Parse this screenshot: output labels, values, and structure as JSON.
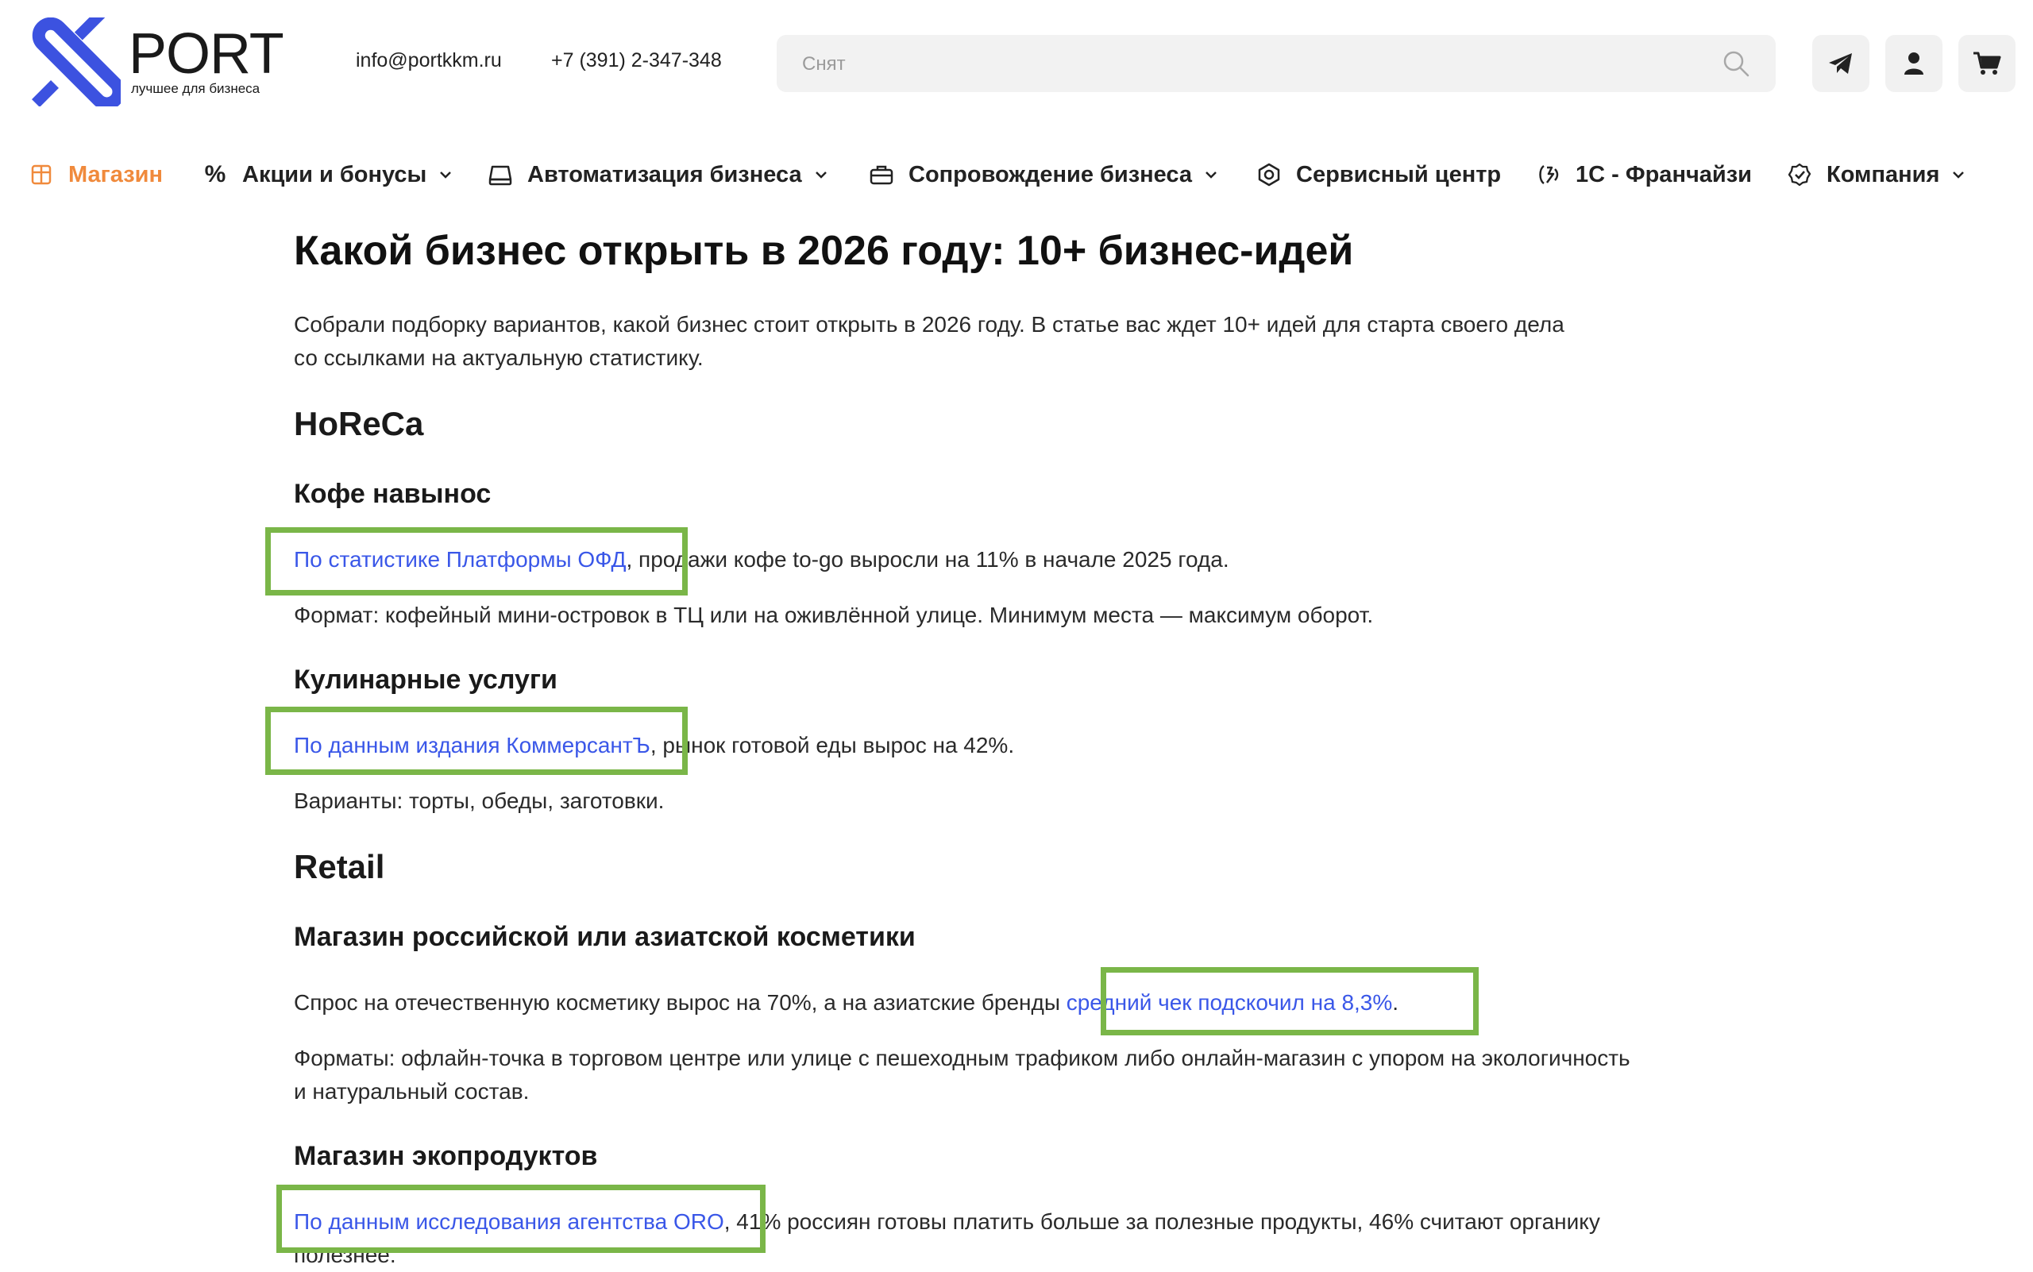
{
  "brand": {
    "name": "PORT",
    "tagline": "лучшее для бизнеса",
    "accent": "#3c52e0"
  },
  "header": {
    "email": "info@portkkm.ru",
    "phone": "+7 (391) 2-347-348",
    "search": {
      "placeholder": "Снят"
    },
    "icons": [
      "telegram-icon",
      "user-icon",
      "cart-icon"
    ]
  },
  "nav": {
    "shop": "Магазин",
    "promo": "Акции и бонусы",
    "automation": "Автоматизация бизнеса",
    "support": "Сопровождение бизнеса",
    "service": "Сервисный центр",
    "franchise": "1С - Франчайзи",
    "company": "Компания",
    "active_color": "#f08a3c"
  },
  "article": {
    "title": "Какой бизнес открыть в 2026 году: 10+ бизнес-идей",
    "intro_1": "Собрали подборку вариантов, какой бизнес стоит открыть в 2026 году. В статье вас ждет 10+ идей для старта своего дела",
    "intro_2": "со ссылками на актуальную статистику.",
    "horeca": "HoReCa",
    "coffee": {
      "heading": "Кофе навынос",
      "link": "По статистике Платформы ОФД",
      "rest": ", продажи кофе to-go выросли на 11% в начале 2025 года.",
      "format": "Формат: кофейный мини-островок в ТЦ или на оживлённой улице. Минимум места — максимум оборот."
    },
    "culinary": {
      "heading": "Кулинарные услуги",
      "link": "По данным издания КоммерсантЪ",
      "rest": ", рынок готовой еды вырос на 42%.",
      "variants": "Варианты: торты, обеды, заготовки."
    },
    "retail": "Retail",
    "cosmetics": {
      "heading": "Магазин российской или азиатской косметики",
      "text_before": "Спрос на отечественную косметику вырос на 70%, а на азиатские бренды ",
      "link": "средний чек подскочил на 8,3%",
      "text_after": ".",
      "formats_1": "Форматы: офлайн-точка в торговом центре или улице с пешеходным трафиком либо онлайн-магазин с упором на экологичность",
      "formats_2": "и натуральный состав."
    },
    "eco": {
      "heading": "Магазин экопродуктов",
      "link": "По данным исследования агентства ORO",
      "rest": ", 41% россиян готовы платить больше за полезные продукты, 46% считают органику",
      "rest_2": "полезнее."
    }
  },
  "highlight_color": "#7ab648",
  "link_color": "#3a57e8"
}
